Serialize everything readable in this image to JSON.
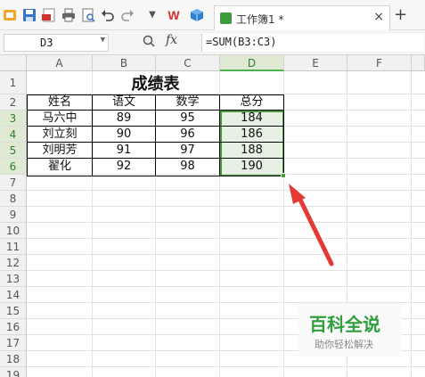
{
  "toolbar": {
    "icons": [
      "app-logo-icon",
      "save-icon",
      "pdf-icon",
      "print-icon",
      "print-preview-icon",
      "undo-icon",
      "redo-icon",
      "more-dropdown-icon",
      "wps-icon",
      "cube-icon"
    ],
    "wps_label": "W",
    "doc_tab": "工作簿1 *",
    "close_glyph": "×",
    "new_tab_glyph": "+"
  },
  "formula_bar": {
    "cell_ref": "D3",
    "fx_label": "fx",
    "formula": "=SUM(B3:C3)"
  },
  "sheet": {
    "columns": [
      "A",
      "B",
      "C",
      "D",
      "E",
      "F"
    ],
    "rows": [
      "1",
      "2",
      "3",
      "4",
      "5",
      "6",
      "7",
      "8",
      "9",
      "10",
      "11",
      "12",
      "13",
      "14",
      "15",
      "16",
      "17",
      "18",
      "19",
      "20"
    ],
    "title": "成绩表",
    "headers": [
      "姓名",
      "语文",
      "数学",
      "总分"
    ],
    "data": [
      [
        "马六中",
        "89",
        "95",
        "184"
      ],
      [
        "刘立刻",
        "90",
        "96",
        "186"
      ],
      [
        "刘明芳",
        "91",
        "97",
        "188"
      ],
      [
        "翟化",
        "92",
        "98",
        "190"
      ]
    ],
    "selected_column": "D",
    "selected_rows": [
      "3",
      "4",
      "5",
      "6"
    ]
  },
  "watermark": {
    "title": "百科全说",
    "subtitle": "助你轻松解决"
  },
  "colors": {
    "accent_green": "#4a9a3b",
    "arrow_red": "#e53935",
    "wps_red": "#d32f2f"
  }
}
